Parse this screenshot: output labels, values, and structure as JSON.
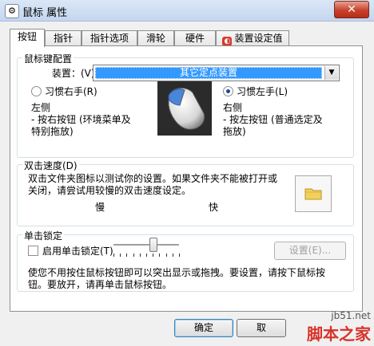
{
  "window": {
    "title": "鼠标 属性",
    "close_label": "✕"
  },
  "tabs": [
    {
      "label": "按钮",
      "active": true
    },
    {
      "label": "指针"
    },
    {
      "label": "指针选项"
    },
    {
      "label": "滑轮"
    },
    {
      "label": "硬件"
    },
    {
      "label": "装置设定值"
    }
  ],
  "mouse_config": {
    "group_title": "鼠标键配置",
    "device_label": "装置：(V)",
    "device_value": "其它定点装置",
    "right_hand_label": "习惯右手(R)",
    "left_hand_label": "习惯左手(L)",
    "left_side_heading": "左侧",
    "left_side_desc_1": "- 按右按钮 (环境菜单及",
    "left_side_desc_2": "特别拖放)",
    "right_side_heading": "右侧",
    "right_side_desc_1": "- 按左按钮 (普通选定及",
    "right_side_desc_2": "拖放)"
  },
  "double_click": {
    "group_title": "双击速度(D)",
    "desc_1": "双击文件夹图标以测试你的设置。如果文件夹不能被打开或",
    "desc_2": "关闭，请尝试用较慢的双击速度设定。",
    "slow_label": "慢",
    "fast_label": "快",
    "speed_level": 0.6
  },
  "click_lock": {
    "group_title": "单击锁定",
    "enable_label": "启用单击锁定(T)",
    "settings_label": "设置(E)...",
    "desc_1": "使您不用按住鼠标按钮即可以突出显示或拖拽。要设置，请按下鼠标按",
    "desc_2": "钮。要放开，请再单击鼠标按钮。"
  },
  "footer": {
    "ok_label": "确定",
    "cancel_label": "取"
  },
  "watermark": {
    "line1": "jb51.net",
    "line2": "脚本之家"
  },
  "colors": {
    "selection": "#3399ff",
    "watermark": "#d8322a",
    "folder": "#f2d15a"
  },
  "icons": [
    "mouse-settings-icon",
    "close-icon",
    "device-settings-icon",
    "chevron-down-icon",
    "mouse-image",
    "folder-icon"
  ]
}
